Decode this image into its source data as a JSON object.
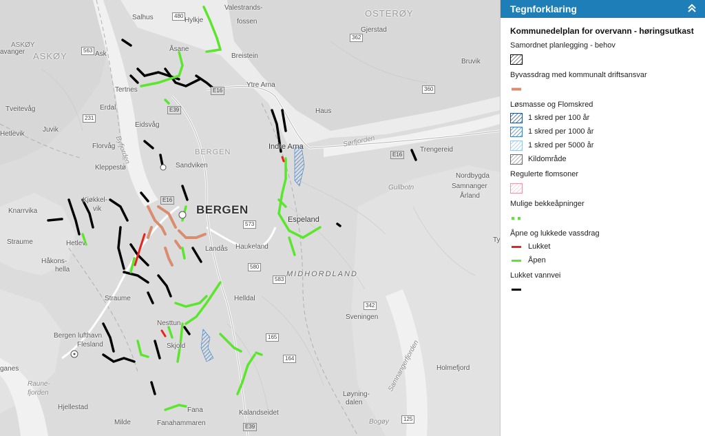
{
  "map": {
    "labels": {
      "salhus": "Salhus",
      "hylkje": "Hylkje",
      "valestrandsfossen_1": "Valestrands-",
      "valestrandsfossen_2": "fossen",
      "osteroy": "OSTERØY",
      "askoy_small": "ASKØY",
      "askoy_big": "ASKØY",
      "avanger": "avanger",
      "ask": "Ask",
      "asane": "Åsane",
      "breistein": "Breistein",
      "gjerstad": "Gjerstad",
      "bruvik": "Bruvik",
      "tertnes": "Tertnes",
      "ytre_arna": "Ytre Arna",
      "tveitevag": "Tveitevåg",
      "erdal": "Erdal",
      "haus": "Haus",
      "hetlevik": "Hetlevik",
      "juvik": "Juvik",
      "eidsvag": "Eidsvåg",
      "byfjorden": "Byfjorden",
      "florvag": "Florvåg",
      "bergen_small": "BERGEN",
      "indre_arna": "Indre Arna",
      "sorfjorden": "Sørfjorden",
      "trengereid": "Trengereid",
      "kleppesto": "Kleppestø",
      "sandviken": "Sandviken",
      "nordbygda": "Nordbygda",
      "samnanger": "Samnanger",
      "arland": "Årland",
      "gullbotn": "Gullbotn",
      "knarrvika": "Knarrvika",
      "kjokkelvik_1": "Kjøkkel-",
      "kjokkelvik_2": "vik",
      "bergen_big": "BERGEN",
      "espeland": "Espeland",
      "straume_1": "Straume",
      "hetlevik2": "Hetlev",
      "landas": "Landås",
      "haukeland": "Haukeland",
      "ty": "Ty",
      "hakonshella_1": "Håkons-",
      "hakonshella_2": "hella",
      "midhordland": "MIDHORDLAND",
      "straume_2": "Straume",
      "helldal": "Helldal",
      "sveningen": "Sveningen",
      "bergen_lufthavn": "Bergen lufthavn",
      "flesland": "Flesland",
      "nesttun": "Nesttun",
      "skjold": "Skjold",
      "holmefjord": "Holmefjord",
      "samnangerfjorden": "Samnangerfjorden",
      "raunefjorden_1": "Raune-",
      "raunefjorden_2": "fjorden",
      "ganes": "ganes",
      "loyning_1": "Løyning-",
      "loyning_2": "dalen",
      "hjellestad": "Hjellestad",
      "fana": "Fana",
      "kalandseidet": "Kalandseidet",
      "milde": "Milde",
      "fanahammaren": "Fanahammaren",
      "bogoy": "Bogøy"
    },
    "roads": {
      "r563": "563",
      "r362": "362",
      "r360": "360",
      "e16a": "E16",
      "e39a": "E39",
      "e16b": "E16",
      "e16c": "E16",
      "r573": "573",
      "r580": "580",
      "r583": "583",
      "r165": "165",
      "r164": "164",
      "r125": "125",
      "e39b": "E39",
      "r480": "480",
      "r342": "342",
      "r231": "231"
    }
  },
  "legend": {
    "header_title": "Tegnforklaring",
    "collapse_icon": "chevron-up-double-icon",
    "layer_title": "Kommunedelplan for overvann - høringsutkast",
    "groups": [
      {
        "title": "Samordnet planlegging - behov",
        "items": [
          {
            "label": "",
            "swatch": "hatch-black"
          }
        ]
      },
      {
        "title": "Byvassdrag med kommunalt driftsansvar",
        "items": [
          {
            "label": "",
            "swatch": "line-salmon"
          }
        ]
      },
      {
        "title": "Løsmasse og Flomskred",
        "items": [
          {
            "label": "1 skred per 100 år",
            "swatch": "hatch-darkblue"
          },
          {
            "label": "1 skred per 1000 år",
            "swatch": "hatch-blue"
          },
          {
            "label": "1 skred per 5000 år",
            "swatch": "hatch-lightblue"
          },
          {
            "label": "Kildområde",
            "swatch": "hatch-grey"
          }
        ]
      },
      {
        "title": "Regulerte flomsoner",
        "items": [
          {
            "label": "",
            "swatch": "hatch-pink"
          }
        ]
      },
      {
        "title": "Mulige bekkeåpninger",
        "items": [
          {
            "label": "",
            "swatch": "dots-green"
          }
        ]
      },
      {
        "title": "Åpne og lukkede vassdrag",
        "items": [
          {
            "label": "Lukket",
            "swatch": "line-red"
          },
          {
            "label": "Åpen",
            "swatch": "line-green"
          }
        ]
      },
      {
        "title": "Lukket vannvei",
        "items": [
          {
            "label": "",
            "swatch": "line-black"
          }
        ]
      }
    ],
    "colors": {
      "header_bg": "#1e7fb8",
      "green": "#5ae62c",
      "red": "#e8231d",
      "black": "#000000",
      "salmon": "#d98c6e",
      "darkblue": "#1f4e8c",
      "blue": "#3d7fc7",
      "lightblue": "#9cc3ea",
      "pink": "#e69aa6"
    }
  }
}
